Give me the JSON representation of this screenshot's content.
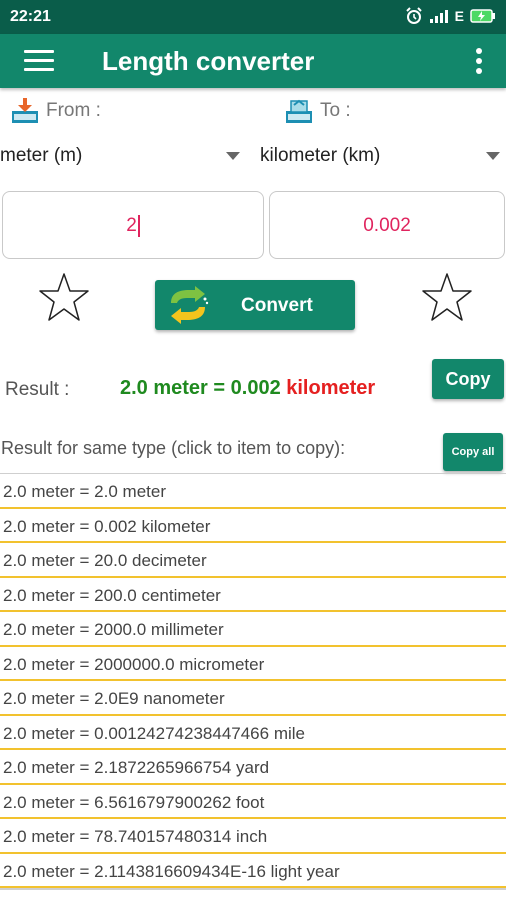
{
  "status": {
    "time": "22:21",
    "network": "E"
  },
  "app": {
    "title": "Length converter"
  },
  "from": {
    "label": "From :",
    "unit": "meter (m)",
    "value": "2"
  },
  "to": {
    "label": "To :",
    "unit": "kilometer (km)",
    "value": "0.002"
  },
  "convert": {
    "label": "Convert"
  },
  "result": {
    "label": "Result :",
    "green1": "2.0 meter",
    "green2": " = 0.002",
    "red": " kilometer",
    "copy_label": "Copy"
  },
  "same_type": {
    "label": "Result for same type (click to item to copy):",
    "copy_all_label": "Copy all"
  },
  "rows": [
    "2.0 meter = 2.0 meter",
    "2.0 meter = 0.002 kilometer",
    "2.0 meter = 20.0 decimeter",
    "2.0 meter = 200.0 centimeter",
    "2.0 meter = 2000.0 millimeter",
    "2.0 meter = 2000000.0 micrometer",
    "2.0 meter = 2.0E9 nanometer",
    "2.0 meter = 0.00124274238447466 mile",
    "2.0 meter = 2.1872265966754 yard",
    "2.0 meter = 6.5616797900262 foot",
    "2.0 meter = 78.740157480314 inch",
    "2.0 meter = 2.1143816609434E-16 light year"
  ],
  "colors": {
    "primary": "#12876b",
    "status": "#0a5d4a",
    "divider": "#f2c22e",
    "input_text": "#e0245e",
    "result_green": "#1f8a1f",
    "result_red": "#e52020"
  },
  "icons": [
    "menu-icon",
    "more-icon",
    "alarm-icon",
    "signal-icon",
    "battery-icon",
    "download-icon",
    "upload-icon",
    "star-icon",
    "swap-icon",
    "dropdown-caret-icon"
  ]
}
